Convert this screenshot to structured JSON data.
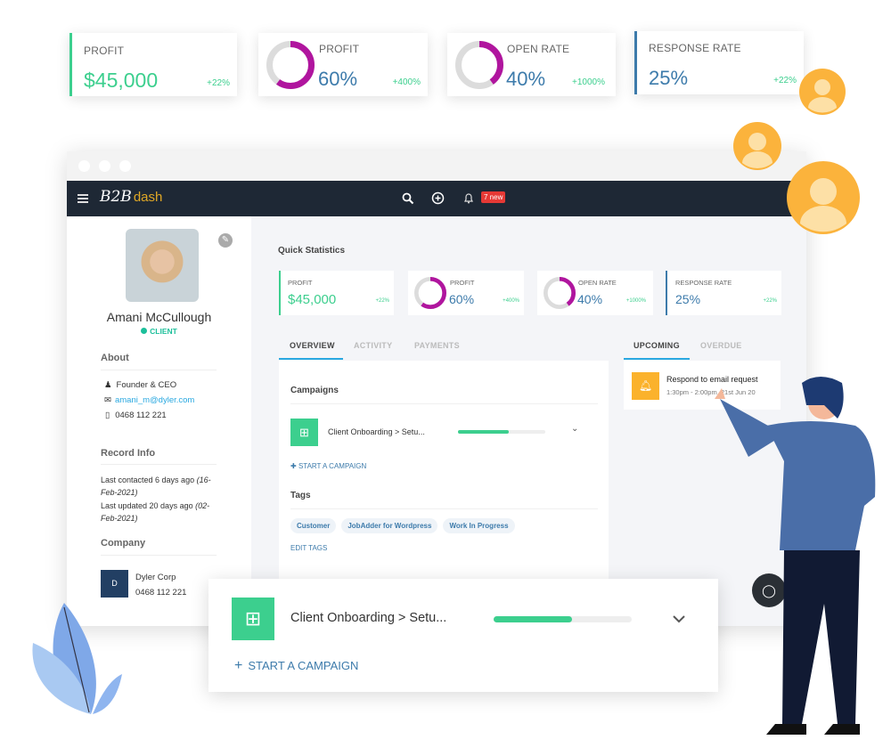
{
  "top_stats": [
    {
      "label": "PROFIT",
      "value": "$45,000",
      "delta": "+22%",
      "type": "bar"
    },
    {
      "label": "PROFIT",
      "value": "60%",
      "delta": "+400%",
      "type": "donut",
      "fraction": 0.6
    },
    {
      "label": "OPEN RATE",
      "value": "40%",
      "delta": "+1000%",
      "type": "donut",
      "fraction": 0.4
    },
    {
      "label": "RESPONSE RATE",
      "value": "25%",
      "delta": "+22%",
      "type": "bar"
    }
  ],
  "app": {
    "logo": "B2B dash",
    "notification_badge": "7 new",
    "icons": [
      "menu-icon",
      "search-icon",
      "add-circle-icon",
      "bell-icon"
    ]
  },
  "profile": {
    "name": "Amani McCullough",
    "status": "CLIENT",
    "about_title": "About",
    "role": "Founder & CEO",
    "email": "amani_m@dyler.com",
    "phone": "0468 112 221",
    "record_title": "Record Info",
    "last_contacted": "Last contacted 6 days ago",
    "last_contacted_date": "(16-Feb-2021)",
    "last_updated": "Last updated 20 days ago",
    "last_updated_date": "(02-Feb-2021)",
    "company_title": "Company",
    "company_initial": "D",
    "company_name": "Dyler Corp",
    "company_phone": "0468 112 221"
  },
  "main": {
    "quick_stats_title": "Quick Statistics",
    "tabs": [
      "OVERVIEW",
      "ACTIVITY",
      "PAYMENTS"
    ],
    "campaigns_title": "Campaigns",
    "campaign_name": "Client Onboarding > Setu...",
    "campaign_progress": 0.58,
    "start_campaign": "START A CAMPAIGN",
    "tags_title": "Tags",
    "tags": [
      "Customer",
      "JobAdder for Wordpress",
      "Work In Progress"
    ],
    "edit_tags": "EDIT TAGS"
  },
  "tasks": {
    "tabs": [
      "UPCOMING",
      "OVERDUE"
    ],
    "item_title": "Respond to email request",
    "item_time": "1:30pm - 2:00pm, 21st Jun 20"
  },
  "floating_campaign": {
    "name": "Client Onboarding > Setu...",
    "progress": 0.57,
    "start_campaign": "START A CAMPAIGN"
  },
  "colors": {
    "green": "#3ccf8e",
    "blue": "#3d7bab",
    "purple": "#b0159e",
    "accent": "#29a8e0",
    "nav": "#1e2835",
    "amber": "#fbb22c"
  }
}
